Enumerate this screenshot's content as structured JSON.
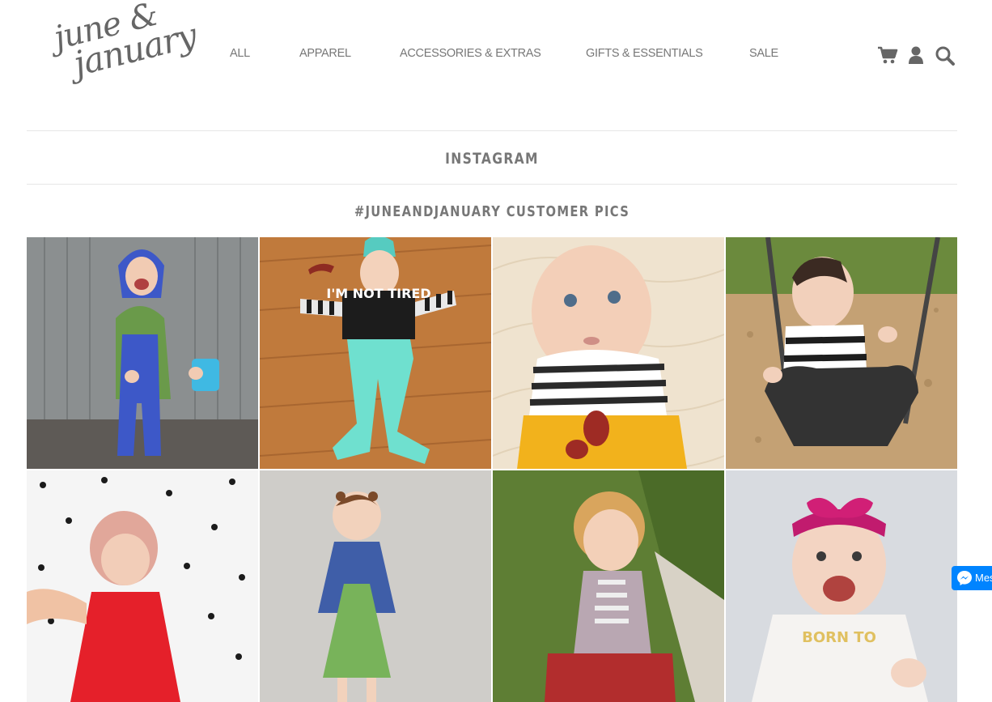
{
  "logo": {
    "line1": "june &",
    "line2": "january"
  },
  "nav": [
    "ALL",
    "APPAREL",
    "ACCESSORIES & EXTRAS",
    "GIFTS & ESSENTIALS",
    "SALE"
  ],
  "icons": [
    "cart-icon",
    "user-icon",
    "search-icon"
  ],
  "page_title": "INSTAGRAM",
  "gallery_title": "#JUNEANDJANUARY CUSTOMER PICS",
  "photos": [
    {
      "caption": ""
    },
    {
      "caption": "I'M NOT TIRED"
    },
    {
      "caption": ""
    },
    {
      "caption": ""
    },
    {
      "caption": ""
    },
    {
      "caption": ""
    },
    {
      "caption": ""
    },
    {
      "caption": "BORN TO"
    }
  ],
  "messenger": {
    "label": "Mes"
  },
  "colors": {
    "text": "#777777",
    "divider": "#e6e6e6",
    "messenger": "#0084ff"
  }
}
